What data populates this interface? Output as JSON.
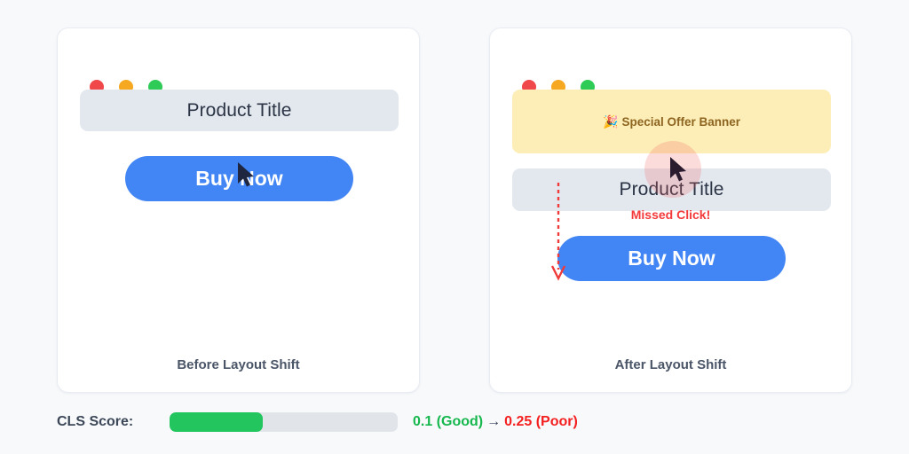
{
  "page": {
    "background_color": "#f7f9fb"
  },
  "panels": [
    {
      "id": "before",
      "caption": "Before Layout Shift",
      "window_dots": [
        {
          "name": "close-dot",
          "color": "#f0474b"
        },
        {
          "name": "minimize-dot",
          "color": "#f6a820"
        },
        {
          "name": "maximize-dot",
          "color": "#2ecb56"
        }
      ],
      "banner": null,
      "title_block": {
        "text": "Product Title"
      },
      "buy_button": {
        "label": "Buy Now",
        "color": "#4285f4"
      },
      "missed_click": null,
      "cursor": {
        "icon": "mouse-pointer-icon",
        "ripple": false
      }
    },
    {
      "id": "after",
      "caption": "After Layout Shift",
      "window_dots": [
        {
          "name": "close-dot",
          "color": "#f0474b"
        },
        {
          "name": "minimize-dot",
          "color": "#f6a820"
        },
        {
          "name": "maximize-dot",
          "color": "#2ecb56"
        }
      ],
      "banner": {
        "emoji": "🎉",
        "text": "Special Offer Banner",
        "background_color": "#fdeeb7",
        "text_color": "#8d6521"
      },
      "title_block": {
        "text": "Product Title"
      },
      "buy_button": {
        "label": "Buy Now",
        "color": "#4285f4"
      },
      "missed_click": {
        "text": "Missed Click!",
        "color": "#f43a3a"
      },
      "cursor": {
        "icon": "mouse-pointer-icon",
        "ripple": true
      }
    }
  ],
  "cls": {
    "label": "CLS Score:",
    "progress_percent": 41,
    "fill_color": "#22c55e",
    "track_color": "#e1e5ea",
    "before_value": "0.1 (Good)",
    "arrow": "→",
    "after_value": "0.25 (Poor)",
    "before_color": "#16b84e",
    "after_color": "#f42020"
  }
}
